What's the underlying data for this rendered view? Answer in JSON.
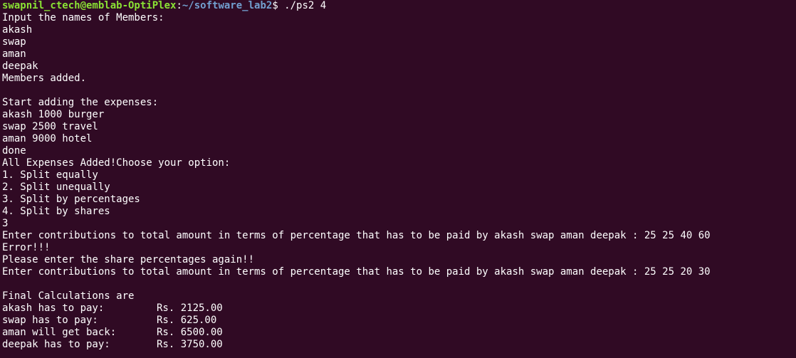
{
  "prompt": {
    "user_host": "swapnil_ctech@emblab-OptiPlex",
    "colon": ":",
    "path": "~/software_lab2",
    "symbol": "$",
    "command": " ./ps2 4"
  },
  "lines": [
    "Input the names of Members:",
    "akash",
    "swap",
    "aman",
    "deepak",
    "Members added.",
    "",
    "Start adding the expenses:",
    "akash 1000 burger",
    "swap 2500 travel",
    "aman 9000 hotel",
    "done",
    "All Expenses Added!Choose your option:",
    "1. Split equally",
    "2. Split unequally",
    "3. Split by percentages",
    "4. Split by shares",
    "3",
    "Enter contributions to total amount in terms of percentage that has to be paid by akash swap aman deepak : 25 25 40 60",
    "Error!!!",
    "Please enter the share percentages again!!",
    "Enter contributions to total amount in terms of percentage that has to be paid by akash swap aman deepak : 25 25 20 30",
    "",
    "Final Calculations are"
  ],
  "results": [
    {
      "label": "akash has to pay:",
      "amount": "Rs. 2125.00"
    },
    {
      "label": "swap has to pay:",
      "amount": "Rs. 625.00"
    },
    {
      "label": "aman will get back:",
      "amount": "Rs. 6500.00"
    },
    {
      "label": "deepak has to pay:",
      "amount": "Rs. 3750.00"
    }
  ],
  "colors": {
    "background": "#300a24",
    "text": "#ffffff",
    "user_host": "#8ae234",
    "path": "#729fcf"
  }
}
